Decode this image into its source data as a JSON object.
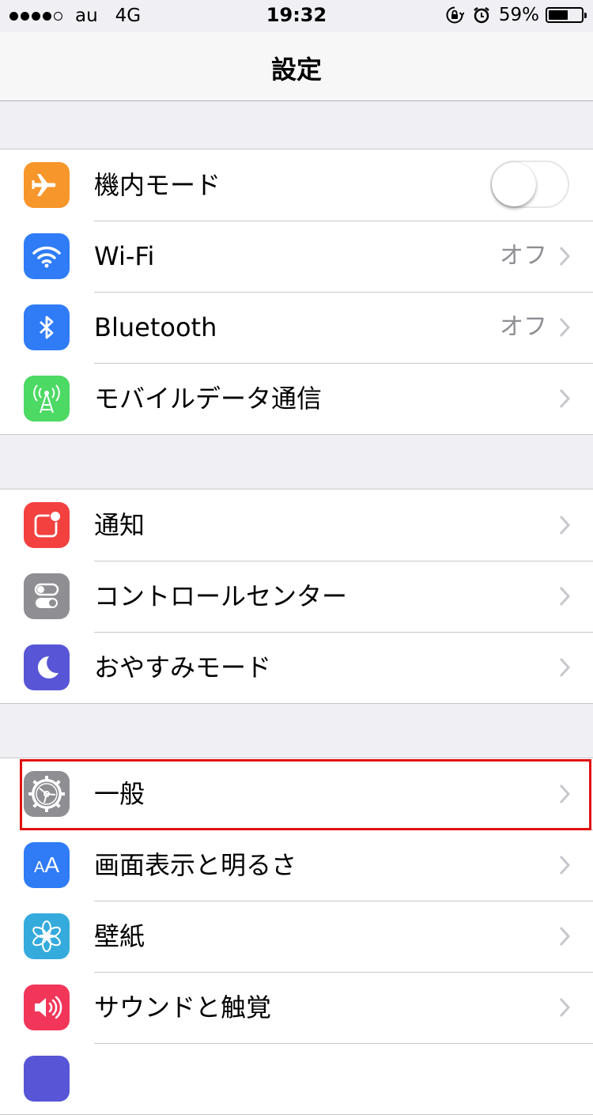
{
  "status_bar": {
    "signal_bars_filled": 4,
    "signal_bars_total": 5,
    "carrier": "au",
    "network": "4G",
    "time": "19:32",
    "battery_percent": "59%",
    "battery_level": 0.59,
    "icons": [
      "rotation-lock-icon",
      "alarm-icon"
    ]
  },
  "nav": {
    "title": "設定"
  },
  "groups": [
    {
      "items": [
        {
          "label": "機内モード",
          "icon": "airplane-icon",
          "icon_color": "#f7962b",
          "control": "toggle",
          "toggle_on": false
        },
        {
          "label": "Wi-Fi",
          "icon": "wifi-icon",
          "icon_color": "#2f7cf6",
          "value": "オフ"
        },
        {
          "label": "Bluetooth",
          "icon": "bluetooth-icon",
          "icon_color": "#2f7cf6",
          "value": "オフ"
        },
        {
          "label": "モバイルデータ通信",
          "icon": "cellular-antenna-icon",
          "icon_color": "#4cd964"
        }
      ]
    },
    {
      "items": [
        {
          "label": "通知",
          "icon": "notifications-icon",
          "icon_color": "#f2413f"
        },
        {
          "label": "コントロールセンター",
          "icon": "control-center-icon",
          "icon_color": "#8e8e93"
        },
        {
          "label": "おやすみモード",
          "icon": "moon-icon",
          "icon_color": "#5856d6"
        }
      ]
    },
    {
      "items": [
        {
          "label": "一般",
          "icon": "gear-icon",
          "icon_color": "#8e8e93",
          "highlighted": true
        },
        {
          "label": "画面表示と明るさ",
          "icon": "display-text-icon",
          "icon_color": "#2f7cf6",
          "icon_text": "AA"
        },
        {
          "label": "壁紙",
          "icon": "wallpaper-flower-icon",
          "icon_color": "#35aadc"
        },
        {
          "label": "サウンドと触覚",
          "icon": "speaker-icon",
          "icon_color": "#f2365a"
        }
      ]
    }
  ],
  "highlight_color": "#e01010"
}
